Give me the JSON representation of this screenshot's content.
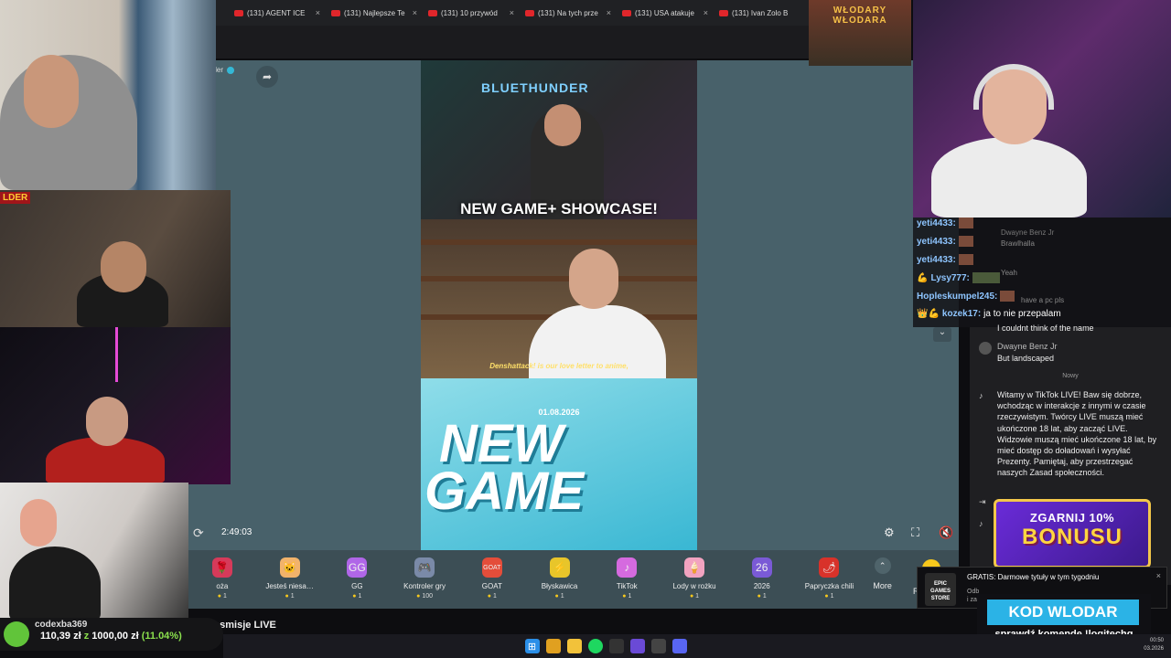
{
  "browser": {
    "tabs": [
      {
        "label": "(131) AGENT ICE"
      },
      {
        "label": "(131) Najlepsze Te"
      },
      {
        "label": "(131) 10 przywód"
      },
      {
        "label": "(131) Na tych prze"
      },
      {
        "label": "(131) USA atakuje"
      },
      {
        "label": "(131) Ivan Zolo B"
      }
    ],
    "close_glyph": "×"
  },
  "stream": {
    "channel_name": "nder",
    "time": "2:49:03",
    "banner": "NEW GAME+ SHOWCASE!",
    "studio_brand": "BLUETHUNDER",
    "subtitle": "Denshattack! is our love letter to anime,",
    "date": "01.08.2026",
    "logo_line1": "NEW",
    "logo_line2": "GAME",
    "chevron": "⌄"
  },
  "gifts": {
    "items": [
      {
        "name": "oża",
        "cost": "1",
        "icon": "rose-icon",
        "glyph": "🌹",
        "color": "#d63a5a"
      },
      {
        "name": "Jesteś niesa…",
        "cost": "1",
        "icon": "cat-icon",
        "glyph": "🐱",
        "color": "#f2b36b"
      },
      {
        "name": "GG",
        "cost": "1",
        "icon": "gg-icon",
        "glyph": "GG",
        "color": "#b066e8"
      },
      {
        "name": "Kontroler gry",
        "cost": "100",
        "icon": "gamepad-icon",
        "glyph": "🎮",
        "color": "#7a8aa8"
      },
      {
        "name": "GOAT",
        "cost": "1",
        "icon": "goat-icon",
        "glyph": "GOAT",
        "color": "#e44d3a"
      },
      {
        "name": "Błyskawica",
        "cost": "1",
        "icon": "lightning-icon",
        "glyph": "⚡",
        "color": "#e8c52a"
      },
      {
        "name": "TikTok",
        "cost": "1",
        "icon": "tiktok-icon",
        "glyph": "♪",
        "color": "#d56adf"
      },
      {
        "name": "Lody w rożku",
        "cost": "1",
        "icon": "ice-cream-icon",
        "glyph": "🍦",
        "color": "#f2a3c0"
      },
      {
        "name": "2026",
        "cost": "1",
        "icon": "year-2026-icon",
        "glyph": "26",
        "color": "#7a5ad6"
      },
      {
        "name": "Papryczka chili",
        "cost": "1",
        "icon": "chili-icon",
        "glyph": "🌶",
        "color": "#d8322a"
      }
    ],
    "more_label": "More",
    "recharge_label": "R"
  },
  "overlay_chat": [
    {
      "user": "yeti4433:",
      "message": ""
    },
    {
      "user": "yeti4433:",
      "message": ""
    },
    {
      "user": "yeti4433:",
      "message": ""
    },
    {
      "user": "Lysy777:",
      "message": ""
    },
    {
      "user": "Hopleskumpel245:",
      "message": ""
    },
    {
      "user": "kozek17:",
      "message": "ja to nie przepalam"
    }
  ],
  "overlay_chat_bg_lines": {
    "l1": "Dwayne Benz Jr",
    "l2": "Brawlhalla",
    "l3": "Yeah",
    "l4": "have a pc pls"
  },
  "chat": {
    "messages": [
      {
        "name": "",
        "text": "I couldnt think of the name"
      },
      {
        "name": "Dwayne Benz Jr",
        "text": "But landscaped"
      }
    ],
    "divider": "Nowy",
    "system_message": "Witamy w TikTok LIVE! Baw się dobrze, wchodząc w interakcje z innymi w czasie rzeczywistym. Twórcy LIVE muszą mieć ukończone 18 lat, aby zacząć LIVE. Widzowie muszą mieć ukończone 18 lat, by mieć dostęp do doładowań i wysyłać Prezenty. Pamiętaj, aby przestrzegać naszych Zasad społeczności."
  },
  "overlays": {
    "corner_title": "WŁODARY WŁODARA",
    "cam2_tag": "LDER",
    "bonus_line1": "ZGARNIJ 10%",
    "bonus_line2": "BONUSU",
    "epic_logo": "EPIC GAMES STORE",
    "epic_title": "GRATIS: Darmowe tytuły w tym tygodniu",
    "epic_sub": "Odb",
    "epic_sub2": "i za",
    "kod_box": "KOD WLODAR",
    "kod_cmd": "sprawdź komendę !logitechg",
    "polecane": "Polecane transmisje LIVE"
  },
  "donation": {
    "user": "codexba369",
    "current": "110,39 zł",
    "separator": "z",
    "goal": "1000,00 zł",
    "percent": "(11.04%)",
    "progress": 0.1104
  },
  "taskbar": {
    "time": "00:50",
    "date": "03.2026"
  },
  "colors": {
    "stage_bg": "#48616a",
    "gift_bar": "#3c4e55",
    "accent_blue": "#2bb3e6",
    "bonus_gold": "#ffd640"
  }
}
